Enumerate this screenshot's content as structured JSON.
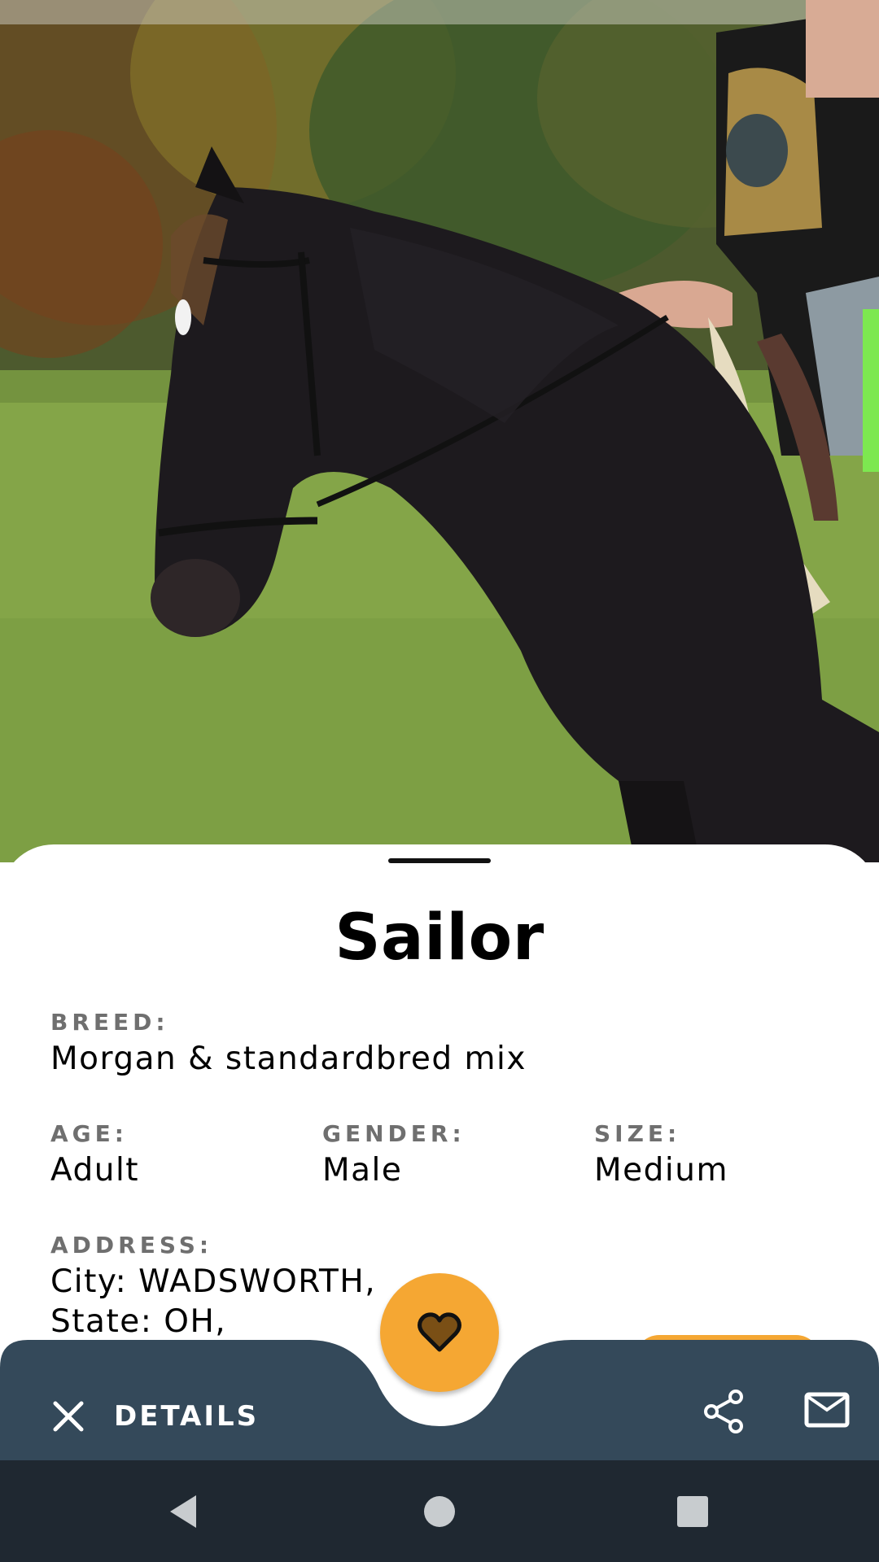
{
  "pet": {
    "name": "Sailor",
    "breed_label": "BREED:",
    "breed": "Morgan & standardbred mix",
    "age_label": "AGE:",
    "age": "Adult",
    "gender_label": "GENDER:",
    "gender": "Male",
    "size_label": "SIZE:",
    "size": "Medium",
    "address_label": "ADDRESS:",
    "address_line1": "City: WADSWORTH,",
    "address_line2": "State: OH,"
  },
  "appbar": {
    "details_label": "DETAILS",
    "close_icon": "close-icon",
    "share_icon": "share-icon",
    "mail_icon": "mail-icon",
    "favorite_icon": "heart-icon"
  },
  "system_nav": {
    "back_icon": "back-triangle-icon",
    "home_icon": "home-circle-icon",
    "recents_icon": "recents-square-icon"
  },
  "colors": {
    "accent": "#f5a733",
    "appbar": "#34495a",
    "system_nav": "#1f2831",
    "label_gray": "#6f6f6f"
  }
}
